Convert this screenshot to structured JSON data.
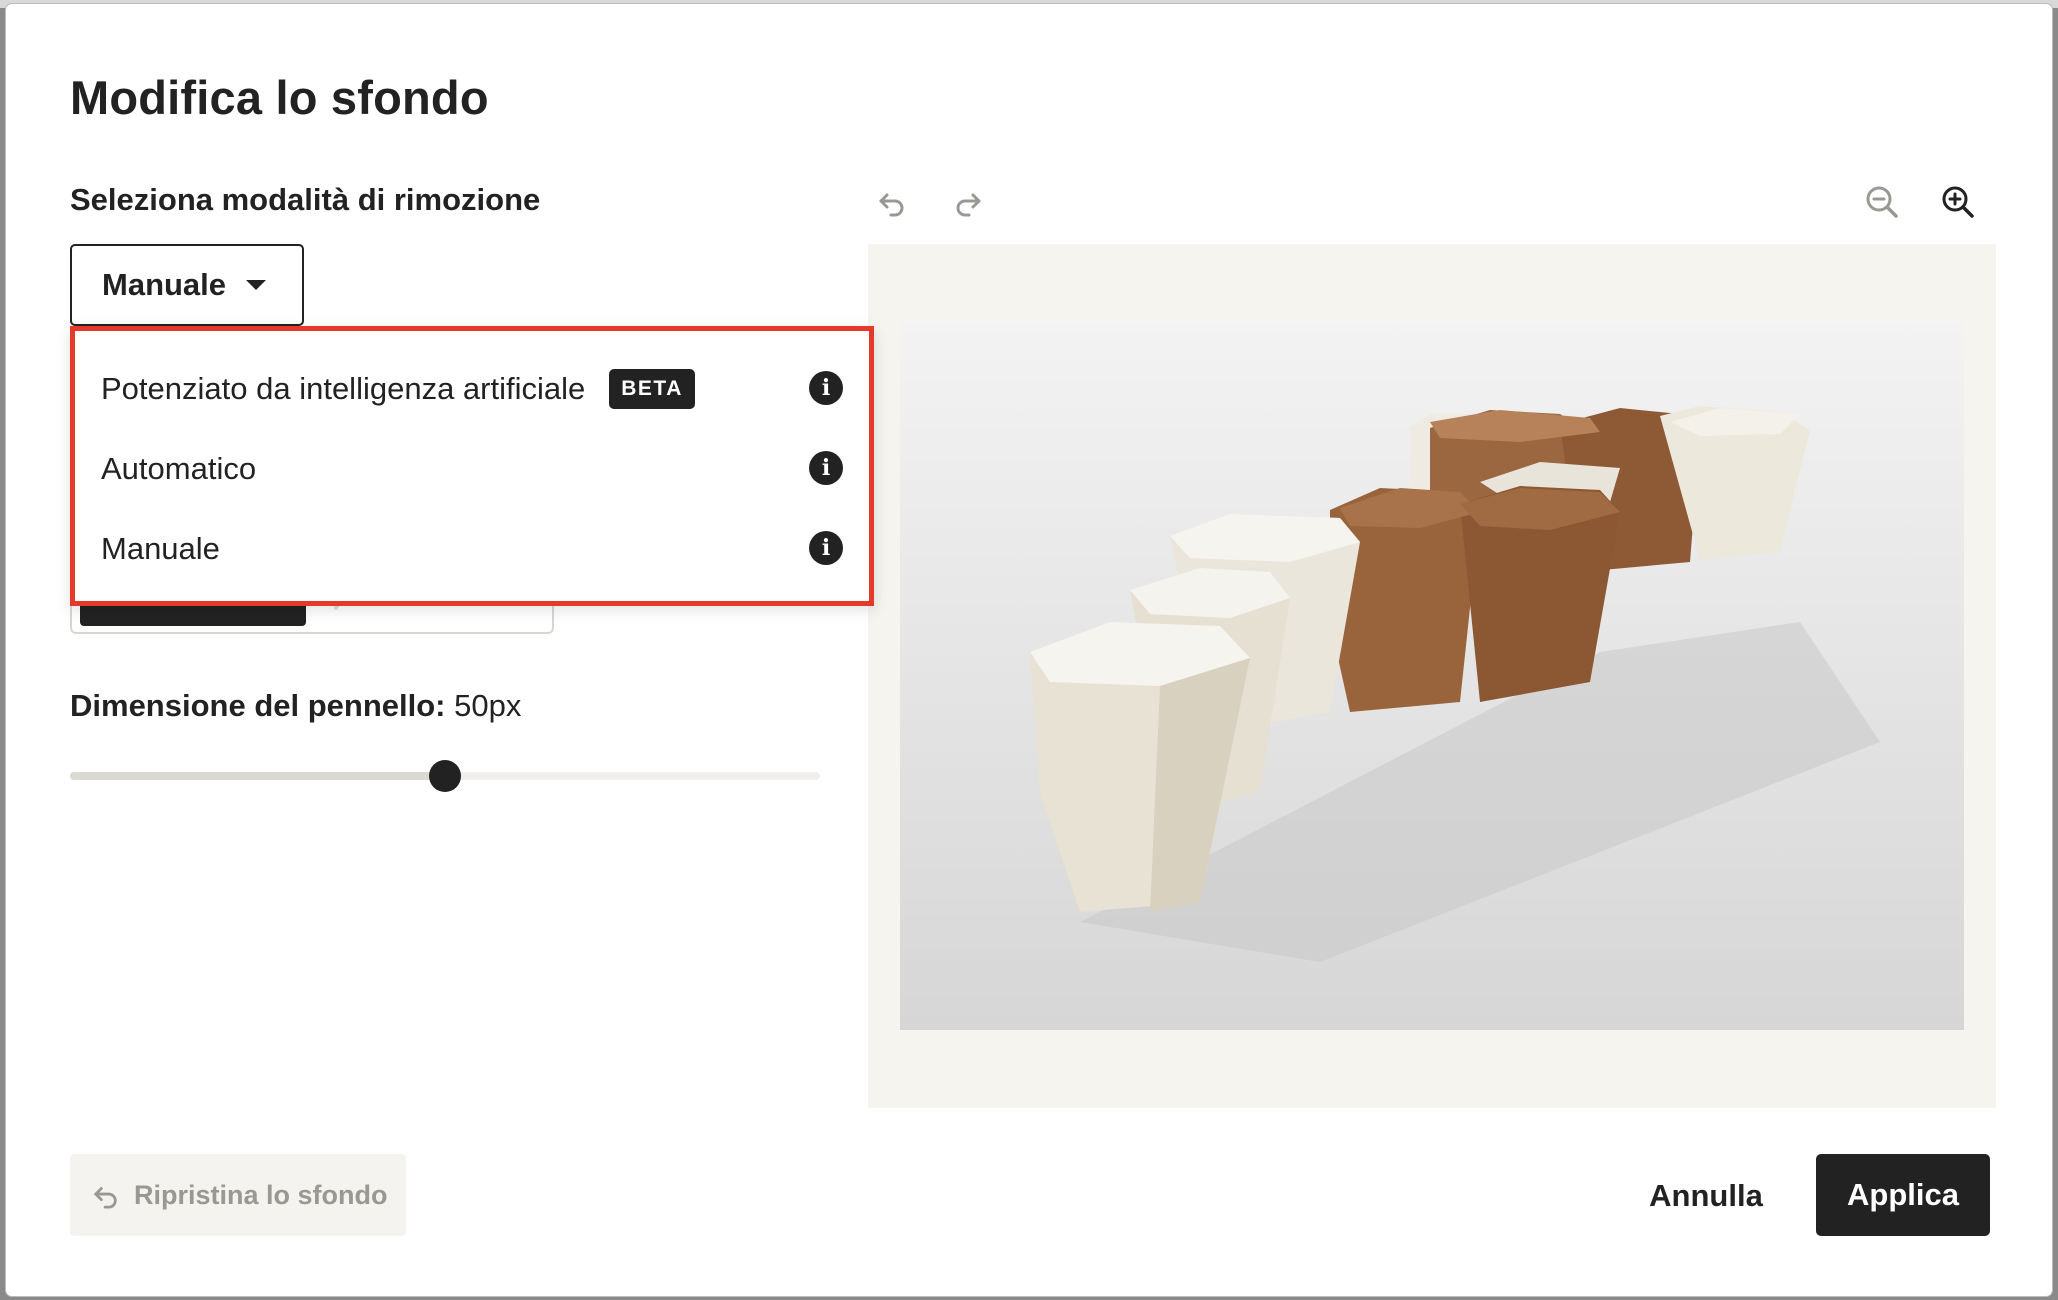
{
  "modal": {
    "title": "Modifica lo sfondo"
  },
  "removal_mode": {
    "label": "Seleziona modalità di rimozione",
    "selected": "Manuale",
    "options": [
      {
        "label": "Potenziato da intelligenza artificiale",
        "badge": "BETA"
      },
      {
        "label": "Automatico"
      },
      {
        "label": "Manuale"
      }
    ]
  },
  "brush": {
    "label": "Dimensione del pennello:",
    "value": "50px",
    "slider_level": 0.5
  },
  "toolbar": {
    "undo_icon": "undo-icon",
    "redo_icon": "redo-icon",
    "zoom_out_icon": "zoom-out-icon",
    "zoom_in_icon": "zoom-in-icon"
  },
  "footer": {
    "reset_label": "Ripristina lo sfondo",
    "cancel_label": "Annulla",
    "apply_label": "Applica"
  },
  "colors": {
    "accent_dark": "#222222",
    "highlight_border": "#e5392a",
    "canvas_bg": "#f5f4ef"
  }
}
